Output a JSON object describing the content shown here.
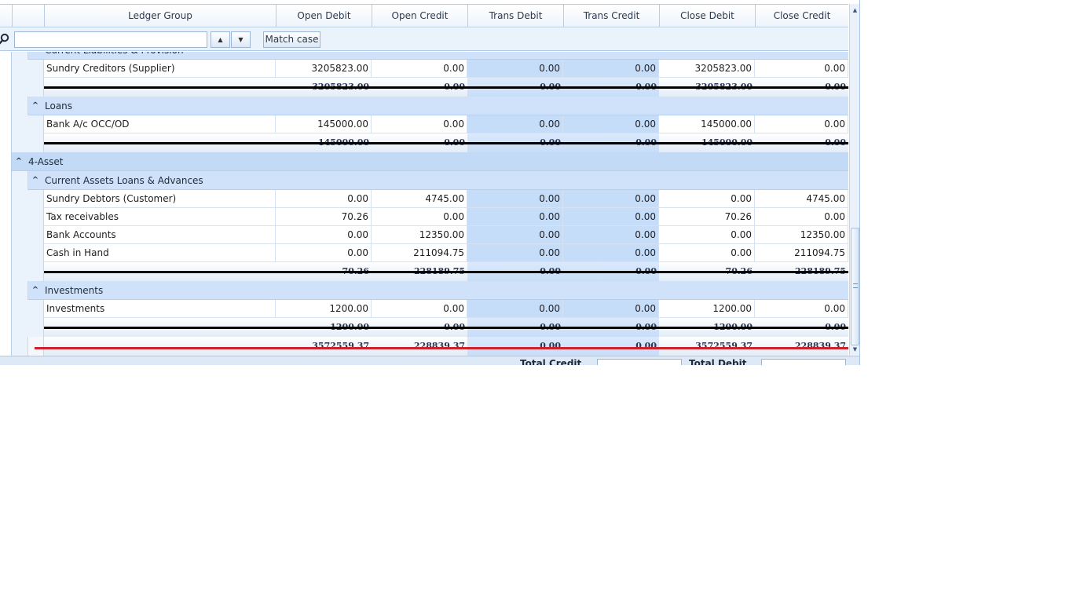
{
  "columns": [
    "Ledger Group",
    "Open Debit",
    "Open Credit",
    "Trans Debit",
    "Trans Credit",
    "Close Debit",
    "Close Credit"
  ],
  "search": {
    "value": "",
    "placeholder": "",
    "match_case_label": "Match case"
  },
  "rows": [
    {
      "kind": "group2",
      "label": "Current Liabilities & Provision"
    },
    {
      "kind": "data",
      "cells": [
        "Sundry Creditors (Supplier)",
        "3205823.00",
        "0.00",
        "0.00",
        "0.00",
        "3205823.00",
        "0.00"
      ]
    },
    {
      "kind": "summary",
      "cells": [
        "3205823.00",
        "0.00",
        "0.00",
        "0.00",
        "3205823.00",
        "0.00"
      ]
    },
    {
      "kind": "group2",
      "label": "Loans"
    },
    {
      "kind": "data",
      "cells": [
        "Bank A/c OCC/OD",
        "145000.00",
        "0.00",
        "0.00",
        "0.00",
        "145000.00",
        "0.00"
      ]
    },
    {
      "kind": "summary",
      "cells": [
        "145000.00",
        "0.00",
        "0.00",
        "0.00",
        "145000.00",
        "0.00"
      ]
    },
    {
      "kind": "group1",
      "label": "4-Asset"
    },
    {
      "kind": "group2",
      "label": "Current Assets Loans & Advances"
    },
    {
      "kind": "data",
      "cells": [
        "Sundry Debtors (Customer)",
        "0.00",
        "4745.00",
        "0.00",
        "0.00",
        "0.00",
        "4745.00"
      ]
    },
    {
      "kind": "data",
      "cells": [
        "Tax receivables",
        "70.26",
        "0.00",
        "0.00",
        "0.00",
        "70.26",
        "0.00"
      ]
    },
    {
      "kind": "data",
      "cells": [
        "Bank Accounts",
        "0.00",
        "12350.00",
        "0.00",
        "0.00",
        "0.00",
        "12350.00"
      ]
    },
    {
      "kind": "data",
      "cells": [
        "Cash in Hand",
        "0.00",
        "211094.75",
        "0.00",
        "0.00",
        "0.00",
        "211094.75"
      ]
    },
    {
      "kind": "summary",
      "cells": [
        "70.26",
        "228189.75",
        "0.00",
        "0.00",
        "70.26",
        "228189.75"
      ]
    },
    {
      "kind": "group2",
      "label": "Investments"
    },
    {
      "kind": "data",
      "cells": [
        "Investments",
        "1200.00",
        "0.00",
        "0.00",
        "0.00",
        "1200.00",
        "0.00"
      ]
    },
    {
      "kind": "summary",
      "cells": [
        "1200.00",
        "0.00",
        "0.00",
        "0.00",
        "1200.00",
        "0.00"
      ]
    },
    {
      "kind": "grandtotal",
      "cells": [
        "3572559.37",
        "228839.37",
        "0.00",
        "0.00",
        "3572559.37",
        "228839.37"
      ]
    }
  ],
  "footer": {
    "total_credit_label": "Total Credit",
    "total_debit_label": "Total Debit"
  },
  "icons": {
    "search": "search-icon",
    "next": "arrow-up-icon",
    "prev": "arrow-down-icon",
    "collapse": "chevron-up-icon"
  },
  "colors": {
    "group_band": "#c3daf7",
    "trans_cell": "#c6ddf9",
    "strike": "#000000",
    "grand_strike": "#d0202c"
  }
}
